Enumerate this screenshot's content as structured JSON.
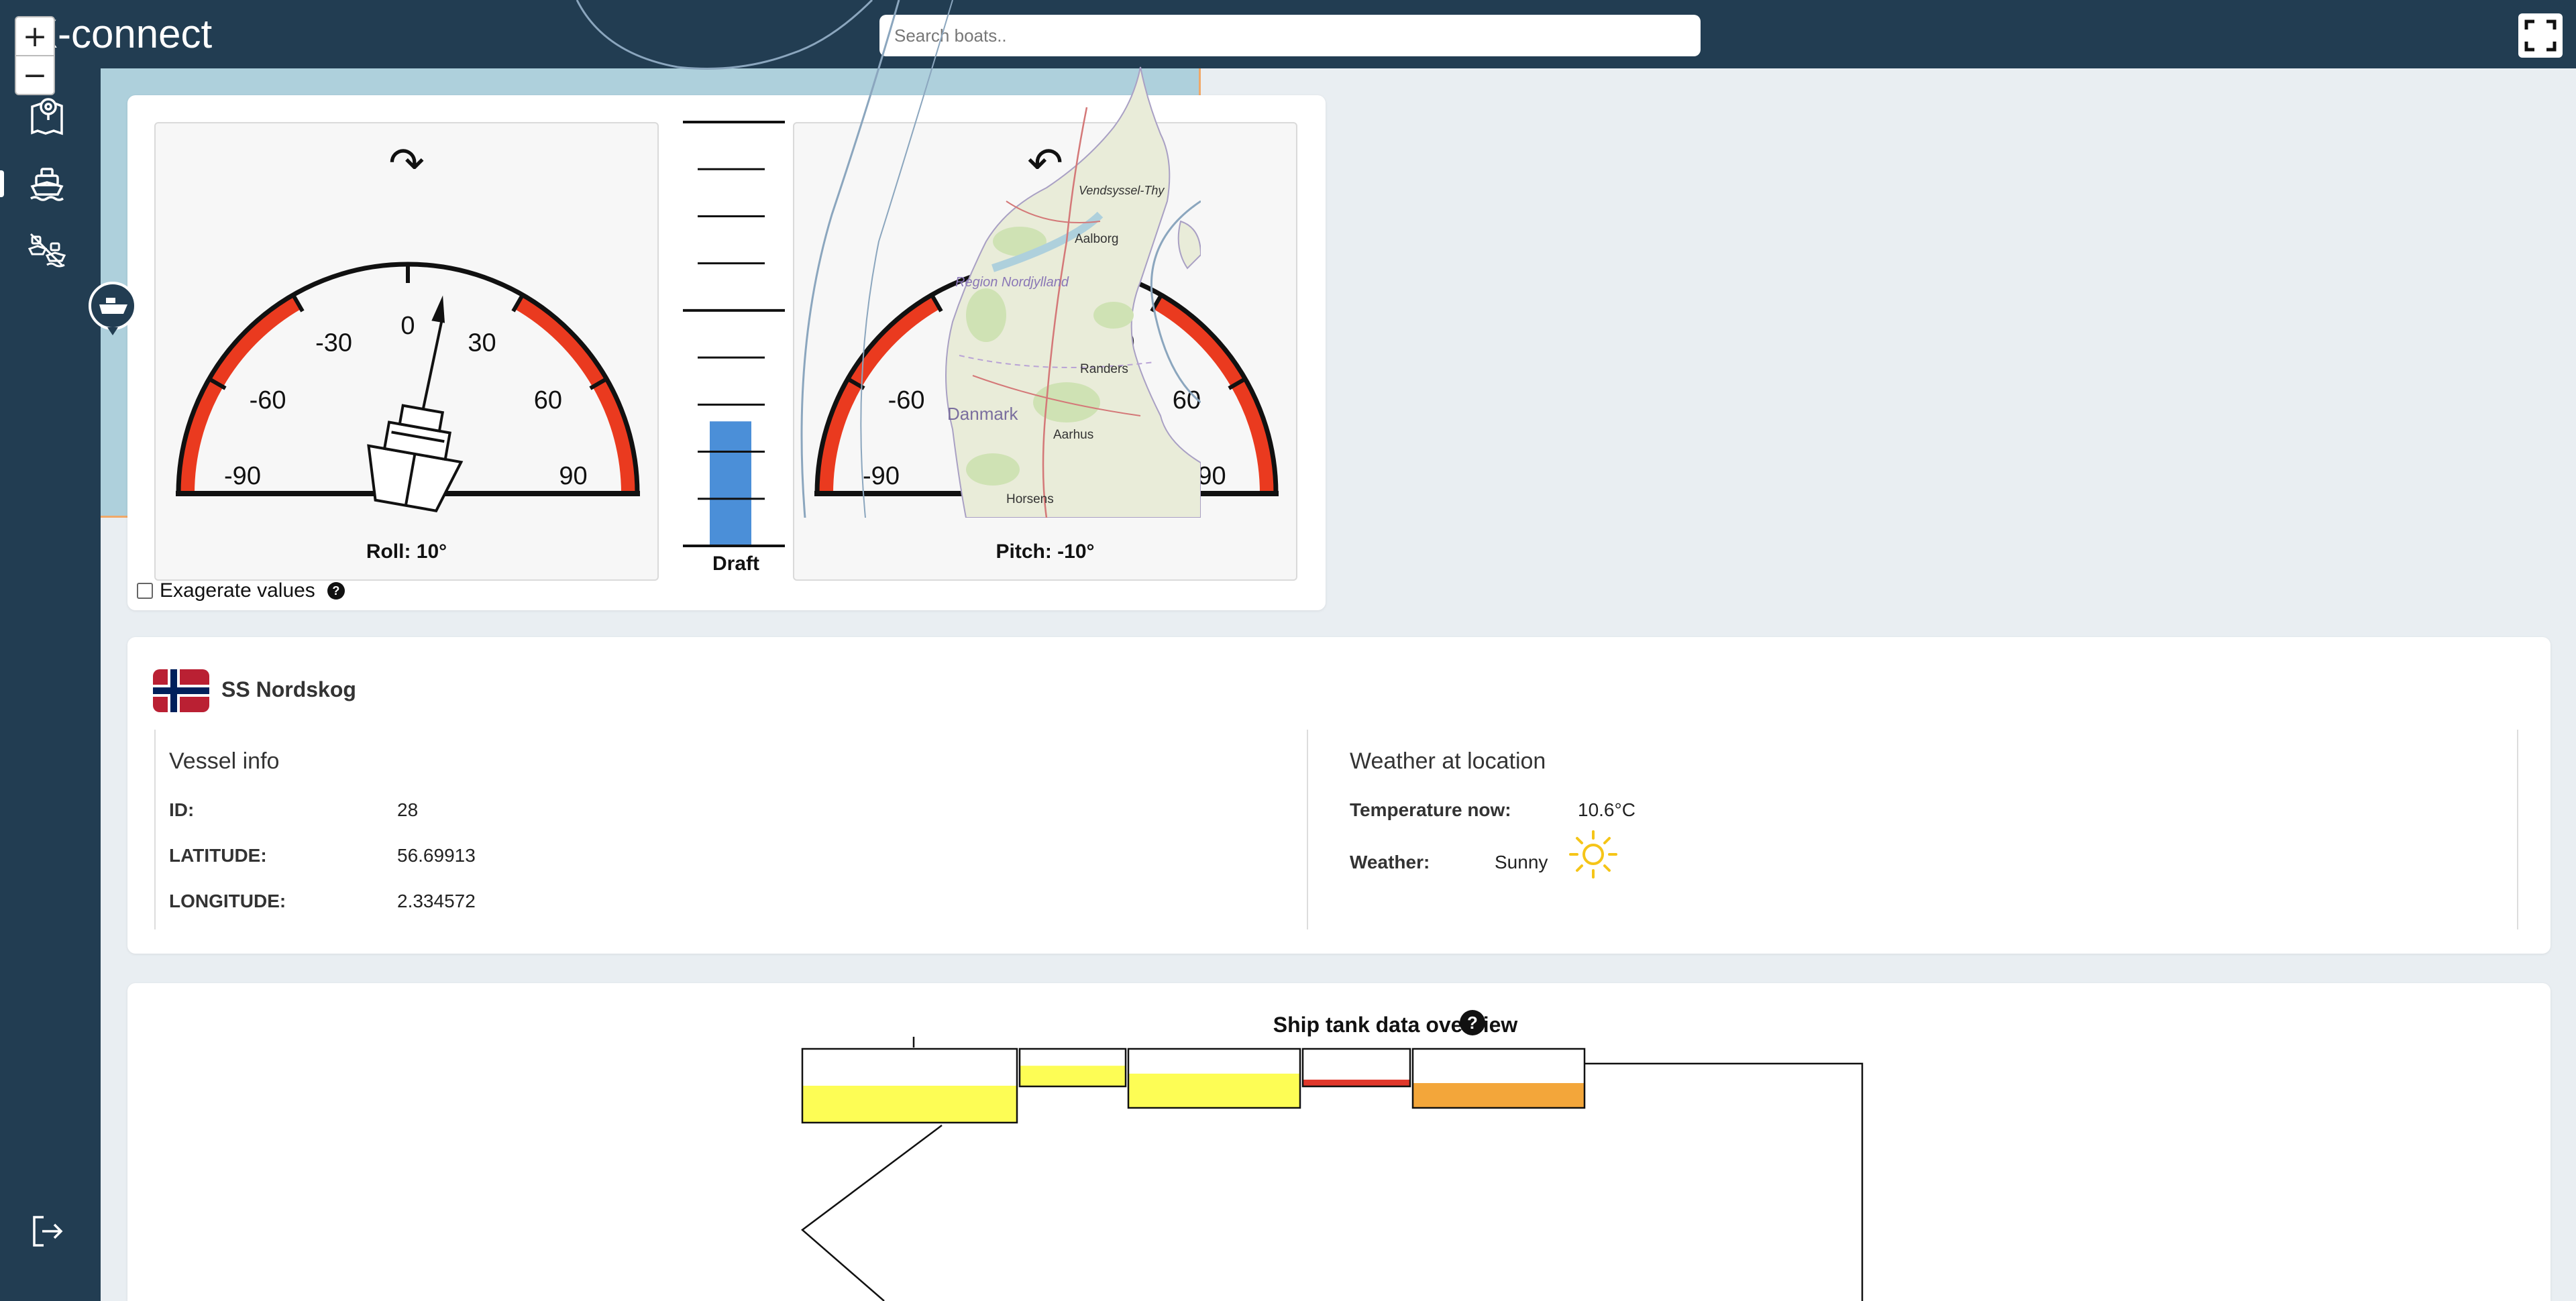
{
  "app": {
    "title": "X-connect"
  },
  "search": {
    "placeholder": "Search boats.."
  },
  "sidebar": {
    "items": [
      {
        "name": "map-icon"
      },
      {
        "name": "ship-icon"
      },
      {
        "name": "ships-disabled-icon"
      }
    ],
    "logout": "logout-icon"
  },
  "gauges": {
    "roll": {
      "label": "Roll: 10°",
      "value": 10,
      "arrow": "↷"
    },
    "pitch": {
      "label": "Pitch: -10°",
      "value": -10,
      "arrow": "↶"
    },
    "ticks": [
      "-90",
      "-60",
      "-30",
      "0",
      "30",
      "60",
      "90"
    ],
    "draft": {
      "label": "Draft",
      "fill_fraction": 0.24
    },
    "exaggerate_label": "Exagerate values",
    "help": "?"
  },
  "map": {
    "zoom_in": "+",
    "zoom_out": "−",
    "places": [
      "Vendsyssel-Thy",
      "Aalborg",
      "Region Nordjylland",
      "Randers",
      "Danmark",
      "Aarhus",
      "Horsens"
    ]
  },
  "vessel": {
    "name": "SS Nordskog",
    "info_title": "Vessel info",
    "rows": [
      {
        "key": "ID:",
        "value": "28"
      },
      {
        "key": "LATITUDE:",
        "value": "56.69913"
      },
      {
        "key": "LONGITUDE:",
        "value": "2.334572"
      }
    ]
  },
  "weather": {
    "title": "Weather at location",
    "temperature_label": "Temperature now:",
    "temperature_value": "10.6°C",
    "weather_label": "Weather:",
    "weather_value": "Sunny",
    "icon": "sun-icon"
  },
  "tanks": {
    "title": "Ship tank data overview",
    "help": "?",
    "items": [
      {
        "level": 0.5,
        "color": "#fdfd55"
      },
      {
        "level": 0.55,
        "color": "#fdfd55"
      },
      {
        "level": 0.58,
        "color": "#fdfd55"
      },
      {
        "level": 0.18,
        "color": "#e0382b"
      },
      {
        "level": 0.42,
        "color": "#f3a63a"
      }
    ]
  },
  "colors": {
    "header": "#223d52",
    "gauge_danger": "#ea3a1f",
    "draft_fill": "#4b8fd8",
    "map_water": "#aed0dc",
    "map_land": "#e9ecd9"
  }
}
